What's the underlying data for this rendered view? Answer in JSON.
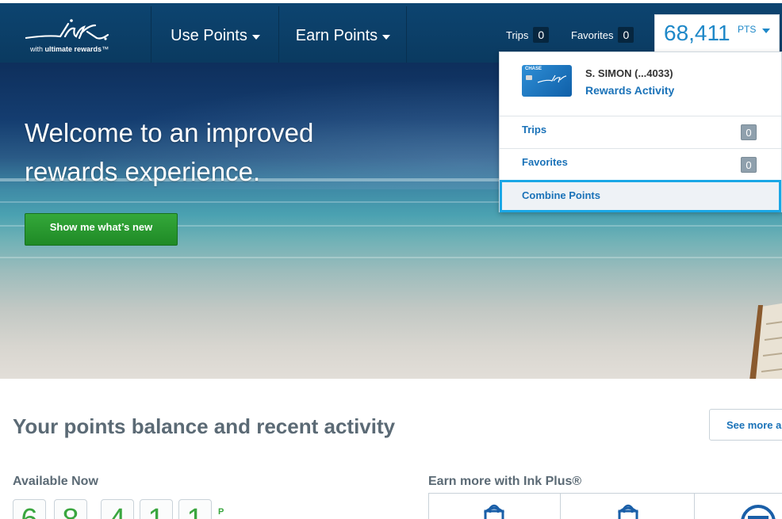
{
  "brand": {
    "logo_word": "ink",
    "logo_sub_prefix": "with",
    "logo_sub_main": "ultimate rewards",
    "logo_sub_tm": "™"
  },
  "nav": {
    "use_points": "Use Points",
    "earn_points": "Earn Points",
    "trips_label": "Trips",
    "trips_count": "0",
    "favorites_label": "Favorites",
    "favorites_count": "0",
    "points_value": "68,411",
    "points_unit": "PTS"
  },
  "hero": {
    "title": "Welcome to an improved rewards experience.",
    "cta": "Show me what’s new"
  },
  "dropdown": {
    "card_brand": "CHASE",
    "account_name": "S. SIMON (...4033)",
    "rewards_activity": "Rewards Activity",
    "items": [
      {
        "label": "Trips",
        "count": "0"
      },
      {
        "label": "Favorites",
        "count": "0"
      }
    ],
    "combine": "Combine Points"
  },
  "balance": {
    "title": "Your points balance and recent activity",
    "see_more": "See more a",
    "available_label": "Available Now",
    "digits": [
      "6",
      "8",
      "4",
      "1",
      "1"
    ],
    "points_letter": "P"
  },
  "earn": {
    "title": "Earn more with Ink Plus®",
    "icons": [
      "shopping-bag-icon",
      "shopping-bag-icon",
      "card-icon"
    ]
  },
  "colors": {
    "nav_bg": "#0d4470",
    "accent_blue": "#1e88c8",
    "link_blue": "#1a72b8",
    "cta_green": "#2a9a31",
    "highlight": "#1aa7e6",
    "heading_gray": "#5b6a75"
  }
}
